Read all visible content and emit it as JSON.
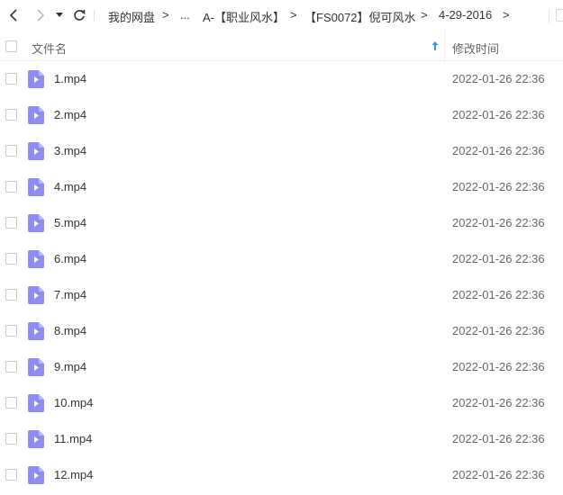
{
  "toolbar": {
    "breadcrumbs": [
      "我的网盘",
      "...",
      "A-【职业风水】",
      "【FS0072】倪可风水",
      "4-29-2016"
    ],
    "separator": ">"
  },
  "header": {
    "name_label": "文件名",
    "time_label": "修改时间",
    "sort_direction": "ascending"
  },
  "colors": {
    "accent": "#2b9af3",
    "video_icon": "#8f8cf0"
  },
  "files": [
    {
      "name": "1.mp4",
      "modified": "2022-01-26 22:36",
      "type_icon": "video-file-icon"
    },
    {
      "name": "2.mp4",
      "modified": "2022-01-26 22:36",
      "type_icon": "video-file-icon"
    },
    {
      "name": "3.mp4",
      "modified": "2022-01-26 22:36",
      "type_icon": "video-file-icon"
    },
    {
      "name": "4.mp4",
      "modified": "2022-01-26 22:36",
      "type_icon": "video-file-icon"
    },
    {
      "name": "5.mp4",
      "modified": "2022-01-26 22:36",
      "type_icon": "video-file-icon"
    },
    {
      "name": "6.mp4",
      "modified": "2022-01-26 22:36",
      "type_icon": "video-file-icon"
    },
    {
      "name": "7.mp4",
      "modified": "2022-01-26 22:36",
      "type_icon": "video-file-icon"
    },
    {
      "name": "8.mp4",
      "modified": "2022-01-26 22:36",
      "type_icon": "video-file-icon"
    },
    {
      "name": "9.mp4",
      "modified": "2022-01-26 22:36",
      "type_icon": "video-file-icon"
    },
    {
      "name": "10.mp4",
      "modified": "2022-01-26 22:36",
      "type_icon": "video-file-icon"
    },
    {
      "name": "11.mp4",
      "modified": "2022-01-26 22:36",
      "type_icon": "video-file-icon"
    },
    {
      "name": "12.mp4",
      "modified": "2022-01-26 22:36",
      "type_icon": "video-file-icon"
    }
  ]
}
